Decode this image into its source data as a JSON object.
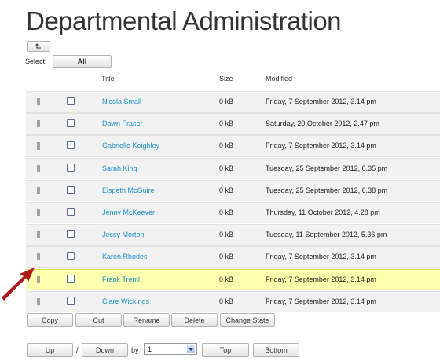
{
  "page": {
    "title": "Departmental Administration"
  },
  "toolbar": {
    "up_level_icon": "up-level-arrow",
    "select_label": "Select:",
    "select_all": "All"
  },
  "columns": {
    "title": "Title",
    "size": "Size",
    "modified": "Modified"
  },
  "rows": [
    {
      "name": "Nicola Small",
      "size": "0 kB",
      "modified": "Friday, 7 September 2012, 3.14 pm"
    },
    {
      "name": "Dawn Fraser",
      "size": "0 kB",
      "modified": "Saturday, 20 October 2012, 2.47 pm"
    },
    {
      "name": "Gabrielle Keighley",
      "size": "0 kB",
      "modified": "Friday, 7 September 2012, 3.14 pm"
    },
    {
      "name": "Sarah King",
      "size": "0 kB",
      "modified": "Tuesday, 25 September 2012, 6.35 pm"
    },
    {
      "name": "Elspeth McGuire",
      "size": "0 kB",
      "modified": "Tuesday, 25 September 2012, 6.38 pm"
    },
    {
      "name": "Jenny McKeever",
      "size": "0 kB",
      "modified": "Thursday, 11 October 2012, 4.28 pm"
    },
    {
      "name": "Jessy Morton",
      "size": "0 kB",
      "modified": "Tuesday, 11 September 2012, 5.36 pm"
    },
    {
      "name": "Karen Rhodes",
      "size": "0 kB",
      "modified": "Friday, 7 September 2012, 3.14 pm"
    },
    {
      "name": "Frank Treml",
      "size": "0 kB",
      "modified": "Friday, 7 September 2012, 3.14 pm",
      "highlighted": true
    },
    {
      "name": "Clare Wickings",
      "size": "0 kB",
      "modified": "Friday, 7 September 2012, 3.14 pm"
    }
  ],
  "actions": {
    "copy": "Copy",
    "cut": "Cut",
    "rename": "Rename",
    "delete": "Delete",
    "change_state": "Change State"
  },
  "ordering": {
    "up": "Up",
    "separator": "/",
    "down": "Down",
    "by_label": "by",
    "by_value": "1",
    "top": "Top",
    "bottom": "Bottom"
  },
  "colors": {
    "link": "#1a8fc8",
    "highlight_row": "#ffffb0",
    "row_background": "#f2f2f2",
    "annotation_arrow": "#b01a1a"
  }
}
